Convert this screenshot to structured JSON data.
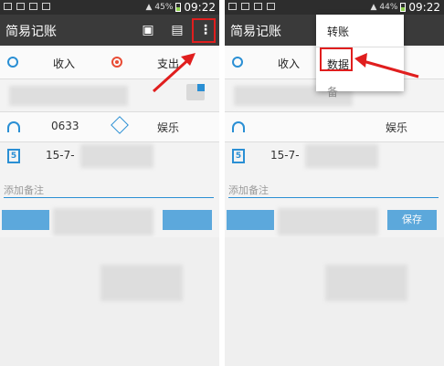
{
  "left": {
    "status": {
      "battery": "45%",
      "time": "09:22"
    },
    "appbar": {
      "title": "简易记账"
    },
    "type": {
      "income": "收入",
      "expense": "支出"
    },
    "category": {
      "account": "0633",
      "name": "娱乐"
    },
    "date": {
      "value": "15-7-"
    },
    "note": {
      "placeholder": "添加备注"
    }
  },
  "right": {
    "status": {
      "battery": "44%",
      "time": "09:22"
    },
    "appbar": {
      "title": "简易记账"
    },
    "type": {
      "income": "收入"
    },
    "category": {
      "name": "娱乐"
    },
    "date": {
      "value": "15-7-"
    },
    "note": {
      "placeholder": "添加备注"
    },
    "save_label": "保存",
    "menu": {
      "items": [
        "转账",
        "数据",
        "备"
      ]
    }
  },
  "colors": {
    "accent": "#2a8fd4",
    "highlight": "#e01e1e",
    "appbar": "#3a3a3a"
  },
  "icons": [
    "save-icon",
    "clipboard-icon",
    "more-vert-icon",
    "calculator-icon",
    "tag-icon",
    "person-icon",
    "calendar-icon"
  ]
}
